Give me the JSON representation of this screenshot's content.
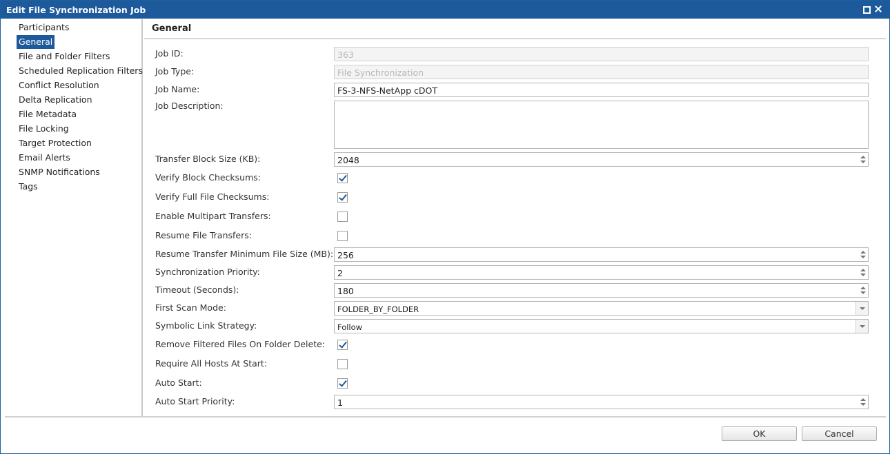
{
  "window": {
    "title": "Edit File Synchronization Job"
  },
  "sidebar": {
    "items": [
      {
        "label": "Participants"
      },
      {
        "label": "General"
      },
      {
        "label": "File and Folder Filters"
      },
      {
        "label": "Scheduled Replication Filters"
      },
      {
        "label": "Conflict Resolution"
      },
      {
        "label": "Delta Replication"
      },
      {
        "label": "File Metadata"
      },
      {
        "label": "File Locking"
      },
      {
        "label": "Target Protection"
      },
      {
        "label": "Email Alerts"
      },
      {
        "label": "SNMP Notifications"
      },
      {
        "label": "Tags"
      }
    ],
    "selected": "General"
  },
  "main": {
    "section_title": "General",
    "fields": {
      "job_id": {
        "label": "Job ID:",
        "value": "363"
      },
      "job_type": {
        "label": "Job Type:",
        "value": "File Synchronization"
      },
      "job_name": {
        "label": "Job Name:",
        "value": "FS-3-NFS-NetApp cDOT"
      },
      "job_description": {
        "label": "Job Description:",
        "value": ""
      },
      "transfer_block_size": {
        "label": "Transfer Block Size (KB):",
        "value": "2048"
      },
      "verify_block_checksums": {
        "label": "Verify Block Checksums:",
        "checked": true
      },
      "verify_full_file_checksums": {
        "label": "Verify Full File Checksums:",
        "checked": true
      },
      "enable_multipart_transfers": {
        "label": "Enable Multipart Transfers:",
        "checked": false
      },
      "resume_file_transfers": {
        "label": "Resume File Transfers:",
        "checked": false
      },
      "resume_min_file_size": {
        "label": "Resume Transfer Minimum File Size (MB):",
        "value": "256"
      },
      "synchronization_priority": {
        "label": "Synchronization Priority:",
        "value": "2"
      },
      "timeout_seconds": {
        "label": "Timeout (Seconds):",
        "value": "180"
      },
      "first_scan_mode": {
        "label": "First Scan Mode:",
        "value": "FOLDER_BY_FOLDER"
      },
      "symbolic_link_strategy": {
        "label": "Symbolic Link Strategy:",
        "value": "Follow"
      },
      "remove_filtered_files": {
        "label": "Remove Filtered Files On Folder Delete:",
        "checked": true
      },
      "require_all_hosts": {
        "label": "Require All Hosts At Start:",
        "checked": false
      },
      "auto_start": {
        "label": "Auto Start:",
        "checked": true
      },
      "auto_start_priority": {
        "label": "Auto Start Priority:",
        "value": "1"
      }
    }
  },
  "footer": {
    "ok_label": "OK",
    "cancel_label": "Cancel"
  },
  "colors": {
    "accent": "#1d5a9c",
    "border": "#b5b5b5",
    "disabled_text": "#b7b7b7"
  }
}
